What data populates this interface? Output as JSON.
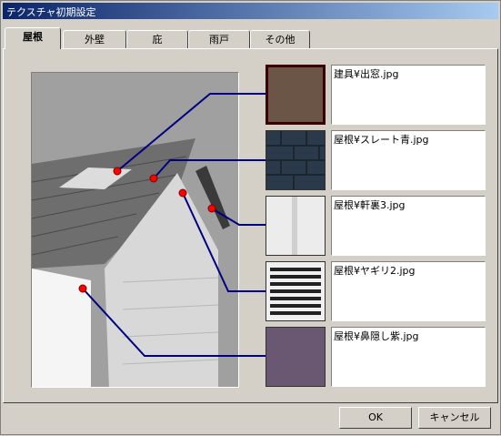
{
  "window": {
    "title": "テクスチャ初期設定"
  },
  "tabs": [
    {
      "label": "屋根"
    },
    {
      "label": "外壁"
    },
    {
      "label": "庇"
    },
    {
      "label": "雨戸"
    },
    {
      "label": "その他"
    }
  ],
  "textures": [
    {
      "file": "建具¥出窓.jpg",
      "color": "#6b5547"
    },
    {
      "file": "屋根¥スレート青.jpg",
      "color": "#2b3a4a"
    },
    {
      "file": "屋根¥軒裏3.jpg",
      "color": "#ececec"
    },
    {
      "file": "屋根¥ヤギリ2.jpg",
      "color": "#f0f0f0"
    },
    {
      "file": "屋根¥鼻隠し紫.jpg",
      "color": "#6a5872"
    }
  ],
  "buttons": {
    "ok": "OK",
    "cancel": "キャンセル"
  },
  "colors": {
    "leader_line": "#000080",
    "marker": "#ff0000"
  }
}
